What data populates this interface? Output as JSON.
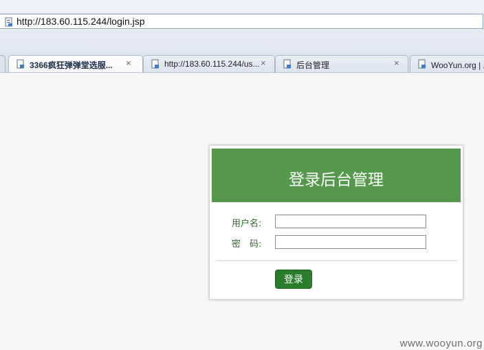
{
  "browser": {
    "address_bar": {
      "url": "http://183.60.115.244/login.jsp"
    },
    "tabs": [
      {
        "title": "3366疯狂弹弹堂选服...",
        "active": true
      },
      {
        "title": "http://183.60.115.244/us...",
        "active": false
      },
      {
        "title": "后台管理",
        "active": false
      },
      {
        "title": "WooYun.org | 发",
        "active": false
      }
    ],
    "tab_close_glyph": "×"
  },
  "login": {
    "title": "登录后台管理",
    "username_label": "用户名:",
    "username_value": "",
    "password_label": "密　码:",
    "password_value": "",
    "submit_label": "登录"
  },
  "colors": {
    "header_green": "#559a4c",
    "button_green": "#2a7d2a",
    "label_green": "#2c6a2a"
  },
  "icons": [
    "page-icon"
  ],
  "watermark": "www.wooyun.org"
}
